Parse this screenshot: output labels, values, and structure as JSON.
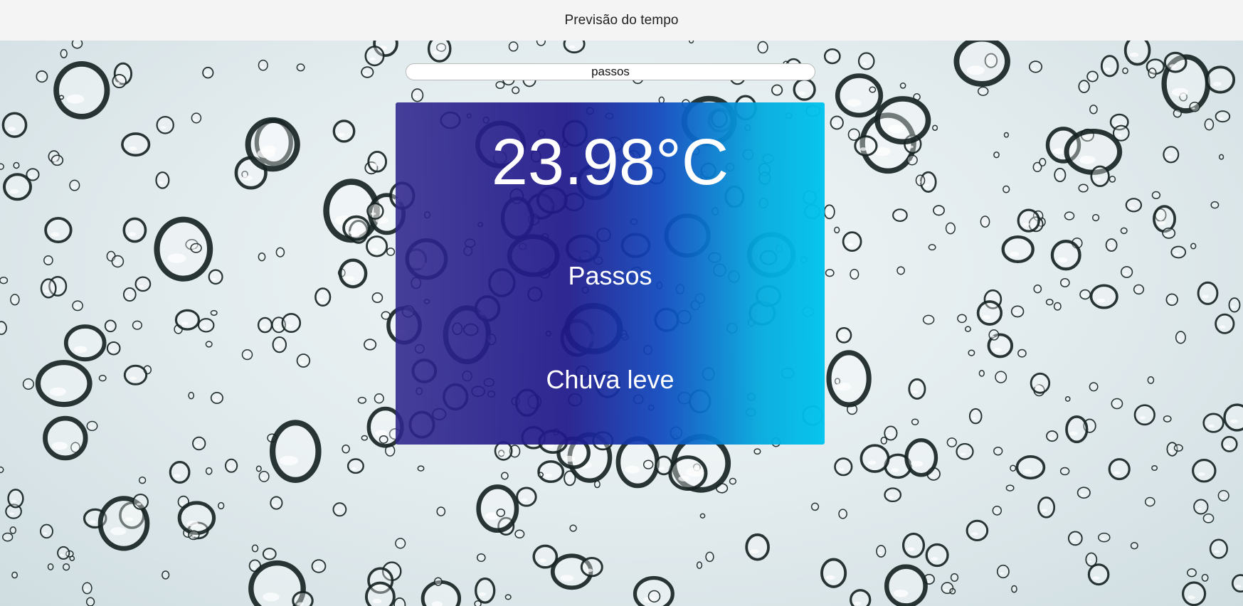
{
  "header": {
    "title": "Previsão do tempo"
  },
  "search": {
    "value": "passos"
  },
  "weather": {
    "temperature": "23.98°C",
    "city": "Passos",
    "description": "Chuva leve"
  },
  "theme": {
    "background_image": "rain-drops-on-glass",
    "card_gradient_start": "#2f268c",
    "card_gradient_end": "#00c4ee",
    "header_background": "#f4f4f4"
  }
}
